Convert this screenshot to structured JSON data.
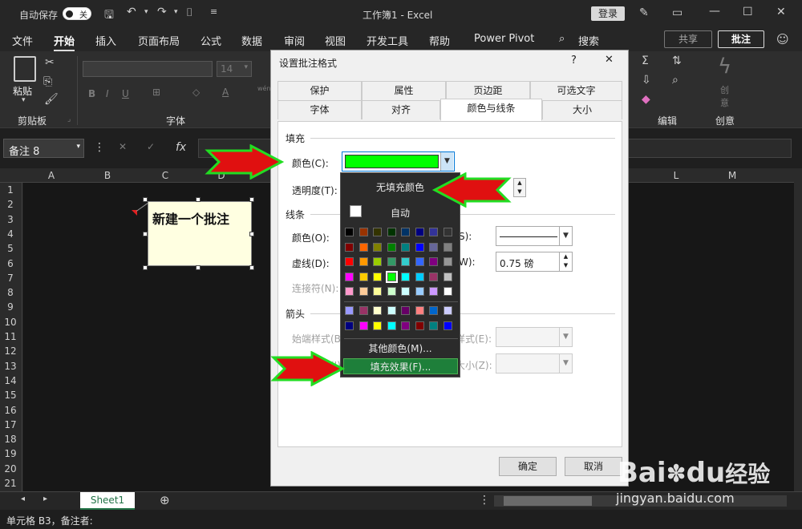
{
  "titlebar": {
    "autosave_label": "自动保存",
    "autosave_state": "关",
    "title": "工作簿1  -  Excel",
    "login": "登录"
  },
  "menubar": {
    "items": [
      "文件",
      "开始",
      "插入",
      "页面布局",
      "公式",
      "数据",
      "审阅",
      "视图",
      "开发工具",
      "帮助",
      "Power Pivot"
    ],
    "search": "搜索",
    "share": "共享",
    "comment": "批注"
  },
  "ribbon": {
    "paste": "粘贴",
    "clipboard": "剪贴板",
    "font": "字体",
    "font_size": "14",
    "edit": "编辑",
    "creative_top": "创",
    "creative_bottom": "意",
    "creative": "创意",
    "wen": "wén"
  },
  "formula": {
    "namebox": "备注 8",
    "fx": "fx"
  },
  "grid": {
    "columns": [
      "A",
      "B",
      "C",
      "D",
      "L",
      "M"
    ],
    "rows": [
      "1",
      "2",
      "3",
      "4",
      "5",
      "6",
      "7",
      "8",
      "9",
      "10",
      "11",
      "12",
      "13",
      "14",
      "15",
      "16",
      "17",
      "18",
      "19",
      "20",
      "21"
    ]
  },
  "comment_text": "新建一个批注",
  "sheet_tab": "Sheet1",
  "status": "单元格 B3，备注者:",
  "dialog": {
    "title": "设置批注格式",
    "help": "?",
    "close": "✕",
    "tabs_row1": [
      "保护",
      "属性",
      "页边距",
      "可选文字"
    ],
    "tabs_row2": [
      "字体",
      "对齐",
      "颜色与线条",
      "大小"
    ],
    "fill_section": "填充",
    "color_label": "颜色(C):",
    "transparency_label": "透明度(T):",
    "line_section": "线条",
    "line_color_label": "颜色(O):",
    "dash_label": "虚线(D):",
    "connector_label": "连接符(N):",
    "style_suffix": "S):",
    "weight_suffix": "W):",
    "weight_value": "0.75 磅",
    "arrow_section": "箭头",
    "begin_style_label": "始端样式(B):",
    "end_style_label": "末端样式(E):",
    "begin_size_label": "始端大小(I):",
    "end_size_label": "末端大小(Z):",
    "ok": "确定",
    "cancel": "取消",
    "fill_color": "#00ff00"
  },
  "color_popup": {
    "no_fill": "无填充颜色",
    "auto": "自动",
    "more_colors": "其他颜色(M)...",
    "fill_effects": "填充效果(F)...",
    "palette": [
      [
        "#000000",
        "#993300",
        "#333300",
        "#003300",
        "#003366",
        "#000080",
        "#333399",
        "#333333"
      ],
      [
        "#800000",
        "#ff6600",
        "#808000",
        "#008000",
        "#008080",
        "#0000ff",
        "#666699",
        "#808080"
      ],
      [
        "#ff0000",
        "#ff9900",
        "#99cc00",
        "#339966",
        "#33cccc",
        "#3366ff",
        "#800080",
        "#969696"
      ],
      [
        "#ff00ff",
        "#ffcc00",
        "#ffff00",
        "#00ff00",
        "#00ffff",
        "#00ccff",
        "#993366",
        "#c0c0c0"
      ],
      [
        "#ff99cc",
        "#ffcc99",
        "#ffff99",
        "#ccffcc",
        "#ccffff",
        "#99ccff",
        "#cc99ff",
        "#ffffff"
      ]
    ],
    "palette2": [
      [
        "#9999ff",
        "#993366",
        "#ffffcc",
        "#ccffff",
        "#660066",
        "#ff8080",
        "#0066cc",
        "#ccccff"
      ],
      [
        "#000080",
        "#ff00ff",
        "#ffff00",
        "#00ffff",
        "#800080",
        "#800000",
        "#008080",
        "#0000ff"
      ]
    ]
  },
  "watermark": {
    "brand": "Bai",
    "brand2": "du",
    "cn": "经验",
    "url": "jingyan.baidu.com"
  },
  "colors": {
    "accent_green": "#217346",
    "arrow_red": "#e01010",
    "arrow_glow": "#22dd22"
  }
}
